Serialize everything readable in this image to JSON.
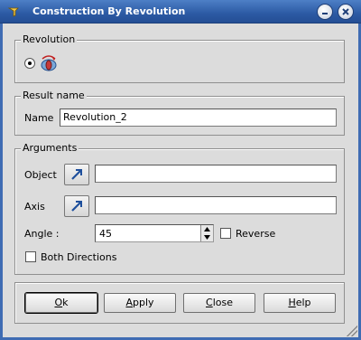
{
  "window": {
    "title": "Construction By Revolution",
    "app_icon": "app-menu-icon",
    "controls": [
      "minimize-icon",
      "close-icon"
    ]
  },
  "revolution_group": {
    "label": "Revolution",
    "option_icon": "revolution-icon",
    "selected": true
  },
  "result_group": {
    "label": "Result name",
    "name_label": "Name",
    "name_value": "Revolution_2"
  },
  "arguments": {
    "label": "Arguments",
    "object_label": "Object",
    "object_value": "",
    "axis_label": "Axis",
    "axis_value": "",
    "select_icon": "arrow-select-icon",
    "angle_label": "Angle :",
    "angle_value": "45",
    "reverse_label": "Reverse",
    "reverse_checked": false,
    "both_directions_label": "Both Directions",
    "both_directions_checked": false
  },
  "buttons": {
    "ok": {
      "pre": "",
      "key": "O",
      "post": "k"
    },
    "apply": {
      "pre": "",
      "key": "A",
      "post": "pply"
    },
    "close": {
      "pre": "",
      "key": "C",
      "post": "lose"
    },
    "help": {
      "pre": "",
      "key": "H",
      "post": "elp"
    }
  },
  "colors": {
    "titlebar": "#2c5aa4",
    "background": "#dcdcdc"
  }
}
